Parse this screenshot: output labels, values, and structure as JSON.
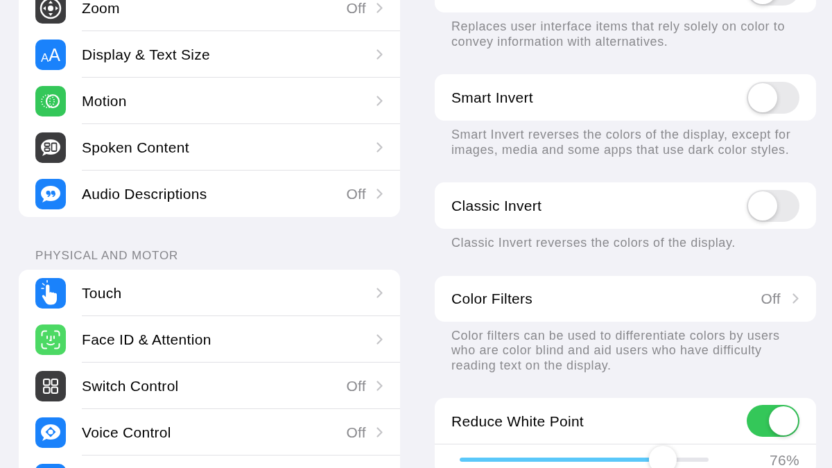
{
  "left_column": {
    "groups": [
      {
        "rows": [
          {
            "kind": "row",
            "label": "Zoom",
            "value": "Off"
          },
          {
            "kind": "row",
            "icon_text": "AA",
            "label": "Display & Text Size"
          },
          {
            "kind": "row",
            "label": "Motion"
          },
          {
            "kind": "row",
            "label": "Spoken Content"
          },
          {
            "kind": "row",
            "label": "Audio Descriptions",
            "value": "Off"
          }
        ]
      },
      {
        "header": "PHYSICAL AND MOTOR",
        "rows": [
          {
            "kind": "row",
            "label": "Touch"
          },
          {
            "kind": "row",
            "label": "Face ID & Attention"
          },
          {
            "kind": "row",
            "label": "Switch Control",
            "value": "Off"
          },
          {
            "kind": "row",
            "label": "Voice Control",
            "value": "Off"
          },
          {
            "kind": "partial"
          }
        ]
      }
    ]
  },
  "right_column": {
    "groups": [
      {
        "rows": [
          {
            "kind": "toggle",
            "on": false
          }
        ],
        "footnote": "Replaces user interface items that rely solely on color to convey information with alternatives."
      },
      {
        "rows": [
          {
            "kind": "toggle",
            "label": "Smart Invert",
            "on": false
          }
        ],
        "footnote": "Smart Invert reverses the colors of the display, except for images, media and some apps that use dark color styles."
      },
      {
        "rows": [
          {
            "kind": "toggle",
            "label": "Classic Invert",
            "on": false
          }
        ],
        "footnote": "Classic Invert reverses the colors of the display."
      },
      {
        "rows": [
          {
            "kind": "link",
            "label": "Color Filters",
            "value": "Off"
          }
        ],
        "footnote": "Color filters can be used to differentiate colors by users who are color blind and aid users who have difficulty reading text on the display."
      },
      {
        "rows": [
          {
            "kind": "toggle",
            "label": "Reduce White Point",
            "on": true
          },
          {
            "kind": "slider",
            "level": 0.76,
            "reading": "76%"
          }
        ]
      }
    ]
  }
}
